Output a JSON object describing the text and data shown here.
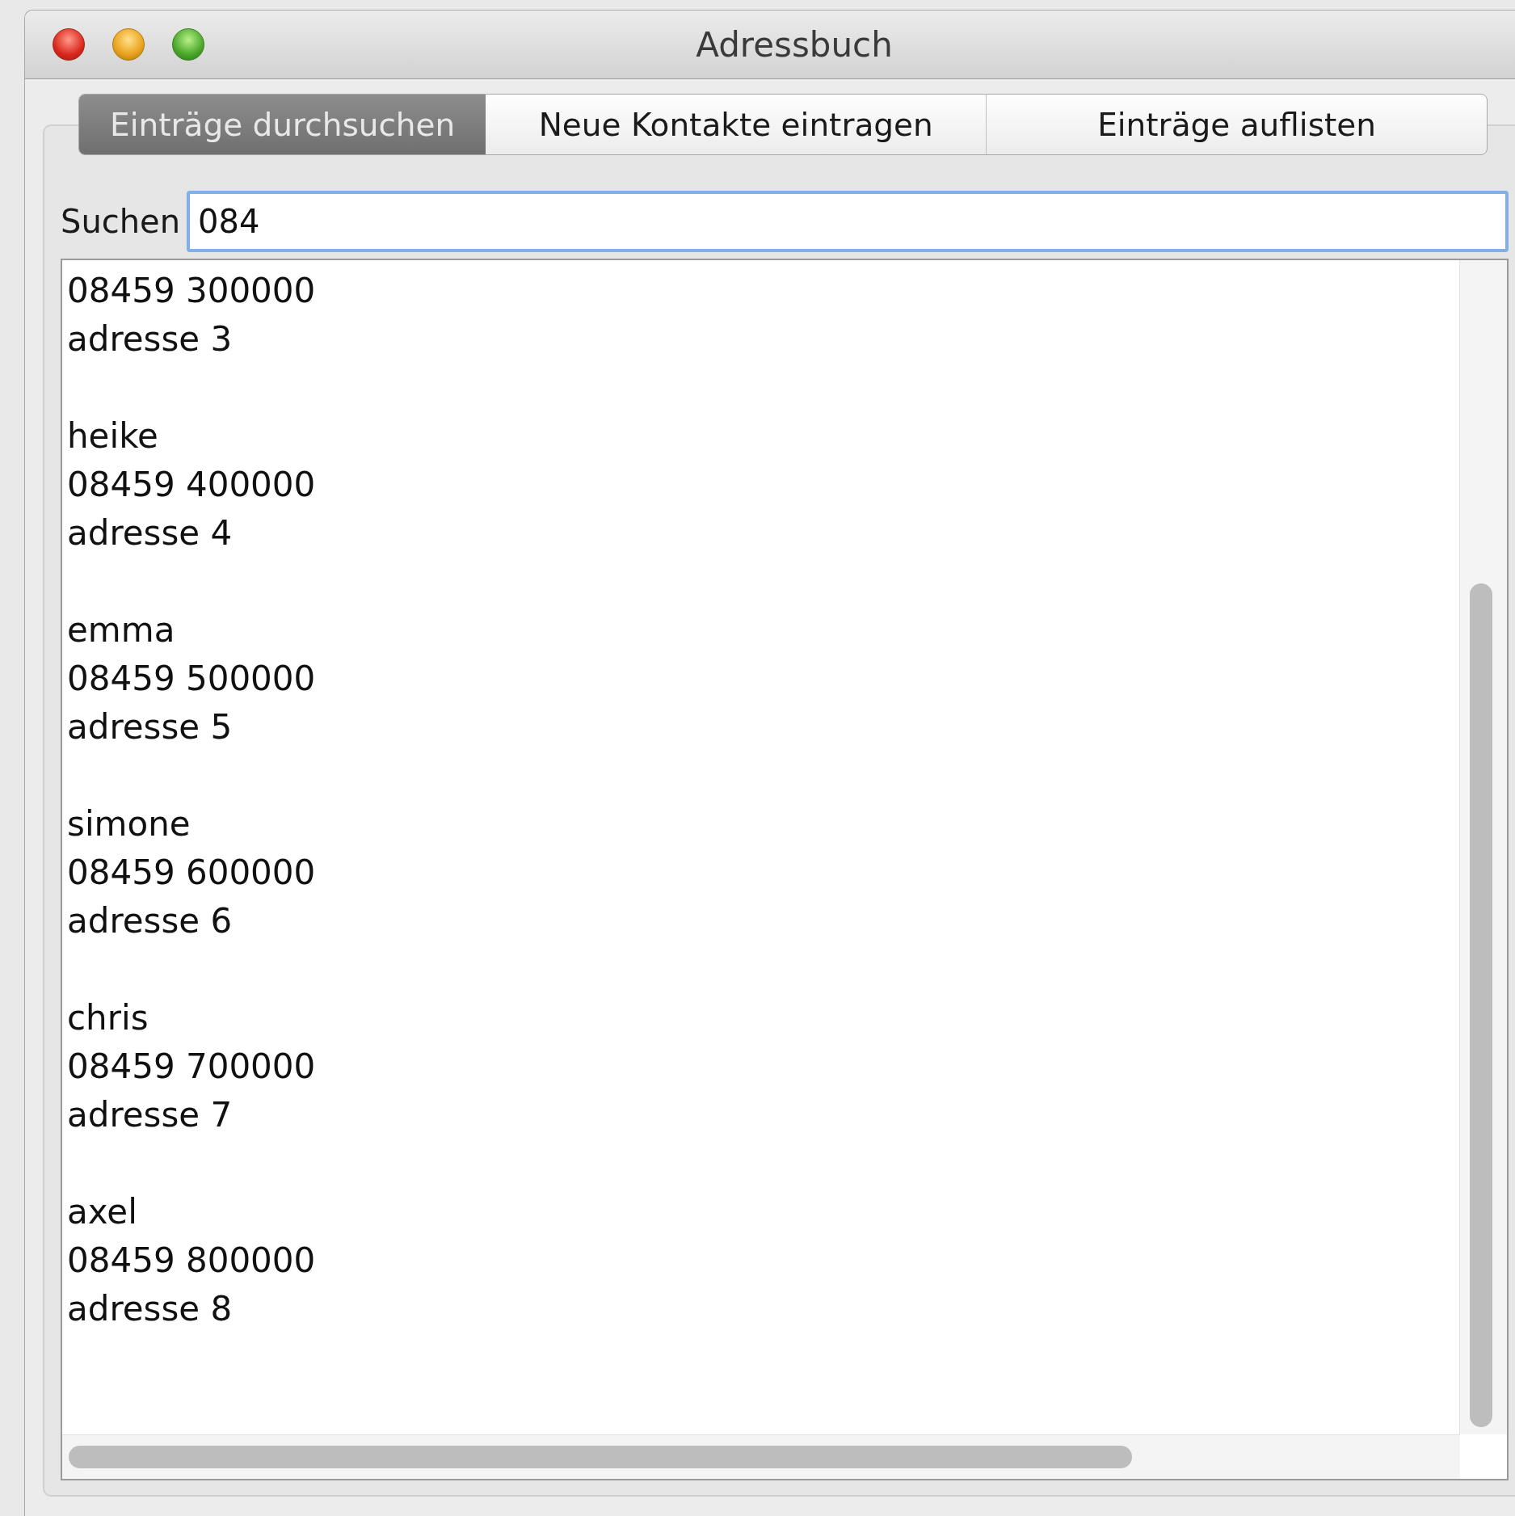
{
  "window": {
    "title": "Adressbuch"
  },
  "tabs": [
    {
      "label": "Einträge durchsuchen",
      "selected": true
    },
    {
      "label": "Neue Kontakte eintragen",
      "selected": false
    },
    {
      "label": "Einträge auflisten",
      "selected": false
    }
  ],
  "search": {
    "label": "Suchen",
    "value": "084"
  },
  "results": [
    {
      "lines": [
        "08459 300000",
        "adresse 3"
      ]
    },
    {
      "lines": [
        "heike",
        "08459 400000",
        "adresse 4"
      ]
    },
    {
      "lines": [
        "emma",
        "08459 500000",
        "adresse 5"
      ]
    },
    {
      "lines": [
        "simone",
        "08459 600000",
        "adresse 6"
      ]
    },
    {
      "lines": [
        "chris",
        "08459 700000",
        "adresse 7"
      ]
    },
    {
      "lines": [
        "axel",
        "08459 800000",
        "adresse 8"
      ]
    }
  ]
}
